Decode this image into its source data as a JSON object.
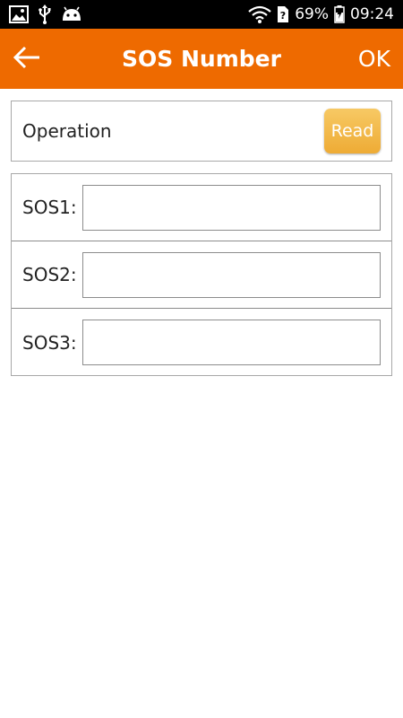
{
  "status_bar": {
    "battery_text": "69%",
    "time": "09:24",
    "icons": [
      "image-icon",
      "usb-icon",
      "android-icon",
      "wifi-icon",
      "sim-icon",
      "battery-icon"
    ]
  },
  "app_bar": {
    "title": "SOS Number",
    "ok_label": "OK",
    "background_color": "#ee6a00"
  },
  "operation": {
    "label": "Operation",
    "read_label": "Read"
  },
  "sos": {
    "items": [
      {
        "label": "SOS1:",
        "value": ""
      },
      {
        "label": "SOS2:",
        "value": ""
      },
      {
        "label": "SOS3:",
        "value": ""
      }
    ]
  }
}
